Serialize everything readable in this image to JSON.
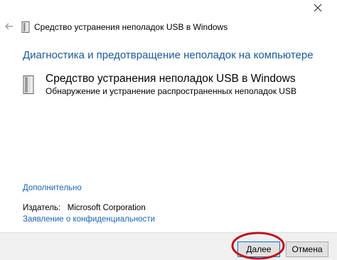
{
  "window": {
    "title": "Средство устранения неполадок USB в Windows",
    "close_glyph": "✕"
  },
  "main": {
    "heading": "Диагностика и предотвращение неполадок на компьютере",
    "item_title": "Средство устранения неполадок USB в Windows",
    "item_description": "Обнаружение и устранение распространенных неполадок USB"
  },
  "links": {
    "advanced": "Дополнительно",
    "privacy": "Заявление о конфиденциальности"
  },
  "publisher": {
    "label": "Издатель:",
    "value": "Microsoft Corporation"
  },
  "footer": {
    "next_label": "Далее",
    "cancel_label": "Отмена"
  },
  "colors": {
    "heading": "#1a5a9c",
    "link": "#1a66b3",
    "annotation": "#c0141c"
  },
  "icons": [
    "back-arrow-icon",
    "usb-device-icon",
    "close-icon"
  ]
}
